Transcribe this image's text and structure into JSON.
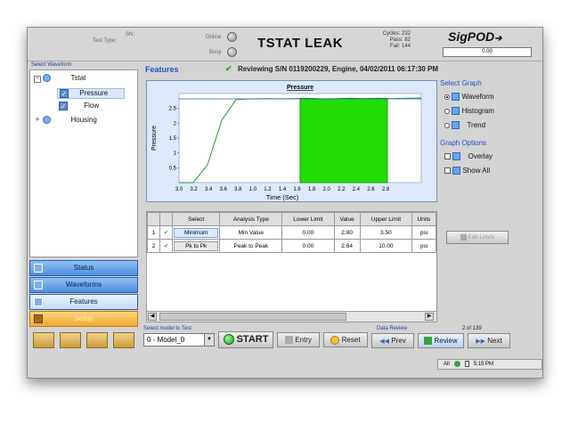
{
  "header": {
    "sn_label": "SN:",
    "test_type_label": "Test Type:",
    "online_label": "Online",
    "busy_label": "Busy",
    "title": "TSTAT LEAK",
    "cycles_label": "Cycles:",
    "cycles_value": "232",
    "pass_label": "Pass:",
    "pass_value": "82",
    "fail_label": "Fail:",
    "fail_value": "144",
    "logo": "SigPOD",
    "readout": "0.00"
  },
  "waveforms": {
    "heading": "Select Waveform",
    "items": [
      {
        "label": "Tstat",
        "expander": "−"
      },
      {
        "label": "Pressure"
      },
      {
        "label": "Flow"
      },
      {
        "label": "Housing",
        "expander": "+"
      }
    ]
  },
  "nav": {
    "status": "Status",
    "waveforms": "Waveforms",
    "features": "Features",
    "setup": "Setup"
  },
  "features": {
    "heading": "Features",
    "reviewing": "Reviewing S/N 0119200229, Engine, 04/02/2011 06:17:30 PM"
  },
  "chart_data": {
    "type": "line",
    "title": "Pressure",
    "xlabel": "Time (Sec)",
    "ylabel": "Pressure",
    "x_ticks": [
      "3.0",
      "3.2",
      "3.4",
      "3.6",
      "3.8",
      "1.0",
      "1.2",
      "1.4",
      "1.6",
      "1.8",
      "2.0",
      "2.2",
      "2.4",
      "2.6",
      "2.8"
    ],
    "y_ticks": [
      "0.5",
      "1",
      "1.5",
      "2",
      "2.5"
    ],
    "ylim": [
      0,
      3
    ],
    "series": [
      {
        "values": [
          0,
          0,
          0.6,
          2.1,
          2.8,
          2.82,
          2.83,
          2.82,
          2.83,
          2.84,
          2.82,
          2.83,
          2.84,
          2.83,
          2.84,
          2.83,
          2.84,
          2.85
        ]
      }
    ],
    "region": {
      "start_fraction": 0.5,
      "end_fraction": 0.86,
      "color": "#22dd00"
    }
  },
  "graph": {
    "select_label": "Select Graph",
    "options": [
      "Waveform",
      "Histogram",
      "Trend"
    ],
    "options_label": "Graph Options",
    "checkboxes": [
      "Overlay",
      "Show All"
    ],
    "edit_limits": "Edit Limits"
  },
  "table": {
    "headers": [
      "Select",
      "Analysis Type",
      "Lower Limit",
      "Value",
      "Upper Limit",
      "Units"
    ],
    "rows": [
      {
        "num": "1",
        "select": "Minimum",
        "analysis": "Min Value",
        "lower": "0.00",
        "value": "2.80",
        "upper": "3.50",
        "units": "psi"
      },
      {
        "num": "2",
        "select": "Pk to Pk",
        "analysis": "Peak to Peak",
        "lower": "0.00",
        "value": "2.64",
        "upper": "10.00",
        "units": "psi"
      }
    ]
  },
  "bottom": {
    "model_label": "Select model to Test",
    "model_value": "0 - Model_0",
    "start": "START",
    "entry": "Entry",
    "reset": "Reset",
    "data_review": "Data Review",
    "prev": "Prev",
    "review": "Review",
    "next": "Next",
    "count": "2 of 139"
  },
  "status": {
    "all": "All",
    "time": "5:15 PM"
  }
}
